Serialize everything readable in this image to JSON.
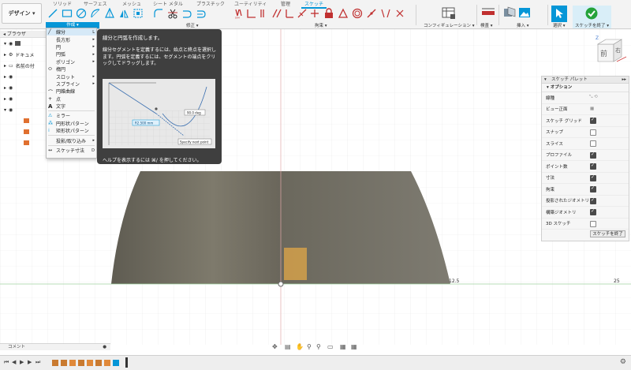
{
  "toolbar": {
    "workspace": "デザイン ▾",
    "tabs": [
      "ソリッド",
      "サーフェス",
      "メッシュ",
      "シート メタル",
      "プラスチック",
      "ユーティリティ",
      "管理",
      "スケッチ"
    ],
    "groups": {
      "create": "作成 ▾",
      "modify": "修正 ▾",
      "constraints": "拘束 ▾",
      "configuration": "コンフィギュレーション ▾",
      "inspect": "検査 ▾",
      "insert": "挿入 ▾",
      "select": "選択 ▾",
      "finish": "スケッチを終了 ▾"
    }
  },
  "browser": {
    "title": "ブラウザ",
    "items": [
      "ドキュメ",
      "名前の付",
      "",
      "",
      "",
      ""
    ]
  },
  "create_menu": {
    "items": [
      {
        "label": "線分",
        "shortcut": "L",
        "highlighted": true
      },
      {
        "label": "長方形",
        "submenu": true
      },
      {
        "label": "円",
        "submenu": true
      },
      {
        "label": "円弧",
        "submenu": true
      },
      {
        "label": "ポリゴン",
        "submenu": true
      },
      {
        "label": "楕円"
      },
      {
        "label": "スロット",
        "submenu": true
      },
      {
        "label": "スプライン",
        "submenu": true
      },
      {
        "label": "円錐曲線"
      },
      {
        "label": "点"
      },
      {
        "label": "文字"
      },
      {
        "label": "ミラー"
      },
      {
        "label": "円形状パターン"
      },
      {
        "label": "矩形状パターン"
      },
      {
        "label": "投影/取り込み",
        "submenu": true
      },
      {
        "label": "スケッチ寸法",
        "shortcut": "D"
      }
    ]
  },
  "tooltip": {
    "title": "線分と円弧を作成します。",
    "description": "線分セグメントを定義するには、始点と終点を選択します。円弧を定義するには、セグメントの端点をクリックしてドラッグします。",
    "hint": "ヘルプを表示するには ⌘/ を押してください。",
    "image_labels": {
      "dimension": "R2.500 mm",
      "angle": "90.0 deg",
      "prompt": "Specify next point"
    }
  },
  "palette": {
    "title": "スケッチ パレット",
    "section": "オプション",
    "rows": [
      {
        "label": "線種",
        "control": "icons"
      },
      {
        "label": "ビュー正面",
        "control": "icon"
      },
      {
        "label": "スケッチ グリッド",
        "checked": true
      },
      {
        "label": "スナップ",
        "checked": false
      },
      {
        "label": "スライス",
        "checked": false
      },
      {
        "label": "プロファイル",
        "checked": true
      },
      {
        "label": "ポイント数",
        "checked": true
      },
      {
        "label": "寸法",
        "checked": true
      },
      {
        "label": "拘束",
        "checked": true
      },
      {
        "label": "投影されたジオメトリ",
        "checked": true
      },
      {
        "label": "構築ジオメトリ",
        "checked": true
      },
      {
        "label": "3D スケッチ",
        "checked": false
      }
    ],
    "finish_button": "スケッチを終了"
  },
  "viewcube": {
    "front": "前",
    "right": "右",
    "axis": "Z"
  },
  "canvas": {
    "label_a": "12.5",
    "label_b": "25"
  },
  "comment_bar": "コメント",
  "colors": {
    "accent": "#0696d7",
    "solid": "#6f6c60",
    "highlight": "#d4a04a",
    "finish": "#24a33a"
  }
}
